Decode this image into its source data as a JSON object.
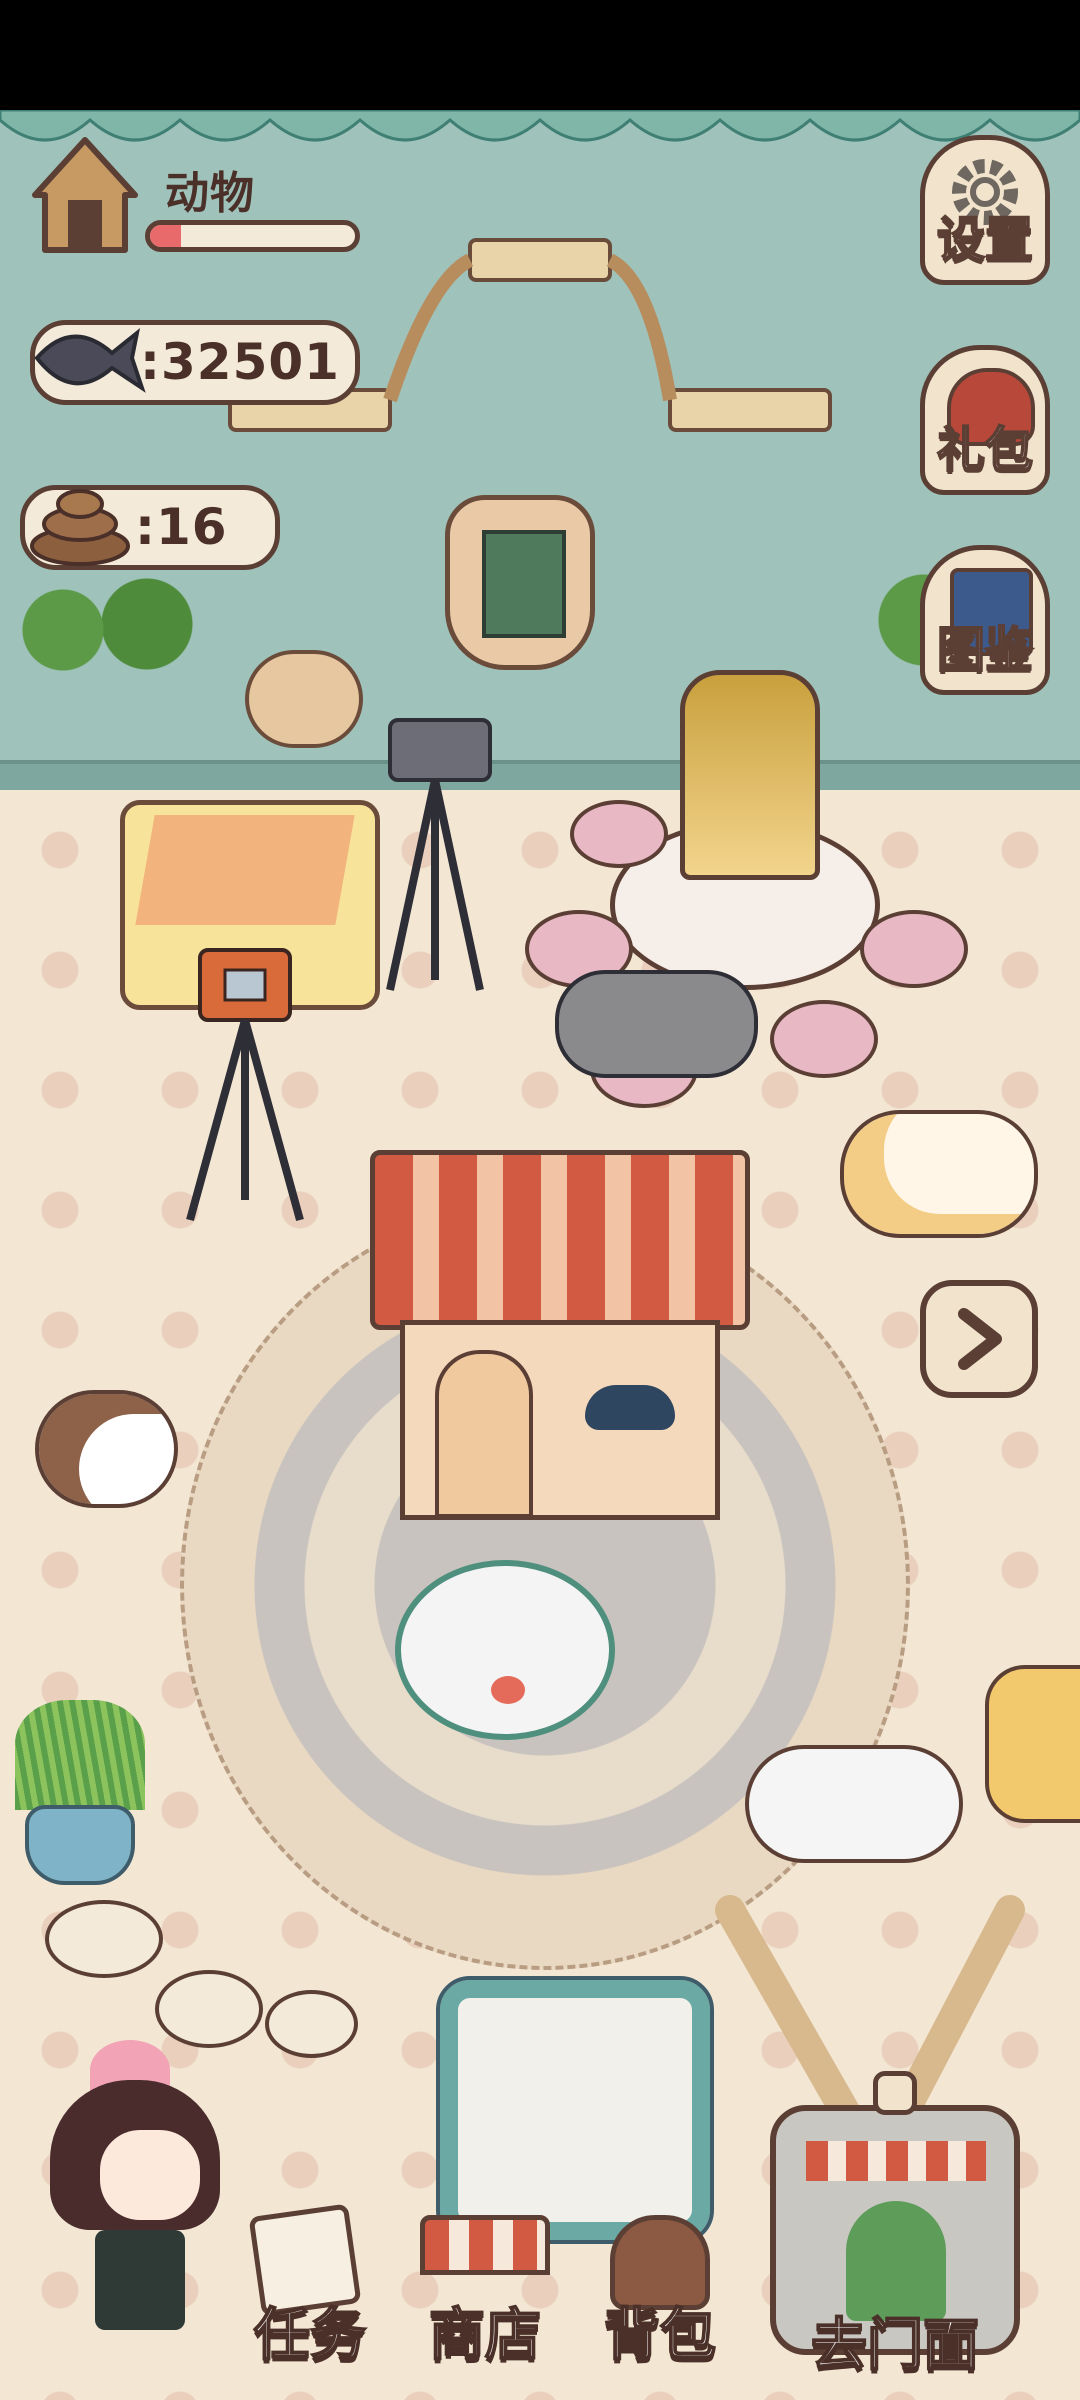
{
  "hud": {
    "animal_label": "动物",
    "animal_progress": 0.15,
    "fish_count": ":32501",
    "poop_count": ":16"
  },
  "side_menu": {
    "settings": "设置",
    "gift": "礼包",
    "encyclopedia": "图鉴"
  },
  "bottom_menu": {
    "tasks": "任务",
    "shop": "商店",
    "backpack": "背包",
    "go_store": "去门面"
  },
  "icons": {
    "house": "house-icon",
    "fish": "fish-icon",
    "poop": "poop-icon",
    "gear": "gear-icon",
    "arrow": "chevron-right-icon"
  },
  "colors": {
    "wall": "#9fc2ba",
    "floor": "#f3e7d4",
    "outline": "#5b3f35",
    "progress_fill": "#e86a6a"
  }
}
